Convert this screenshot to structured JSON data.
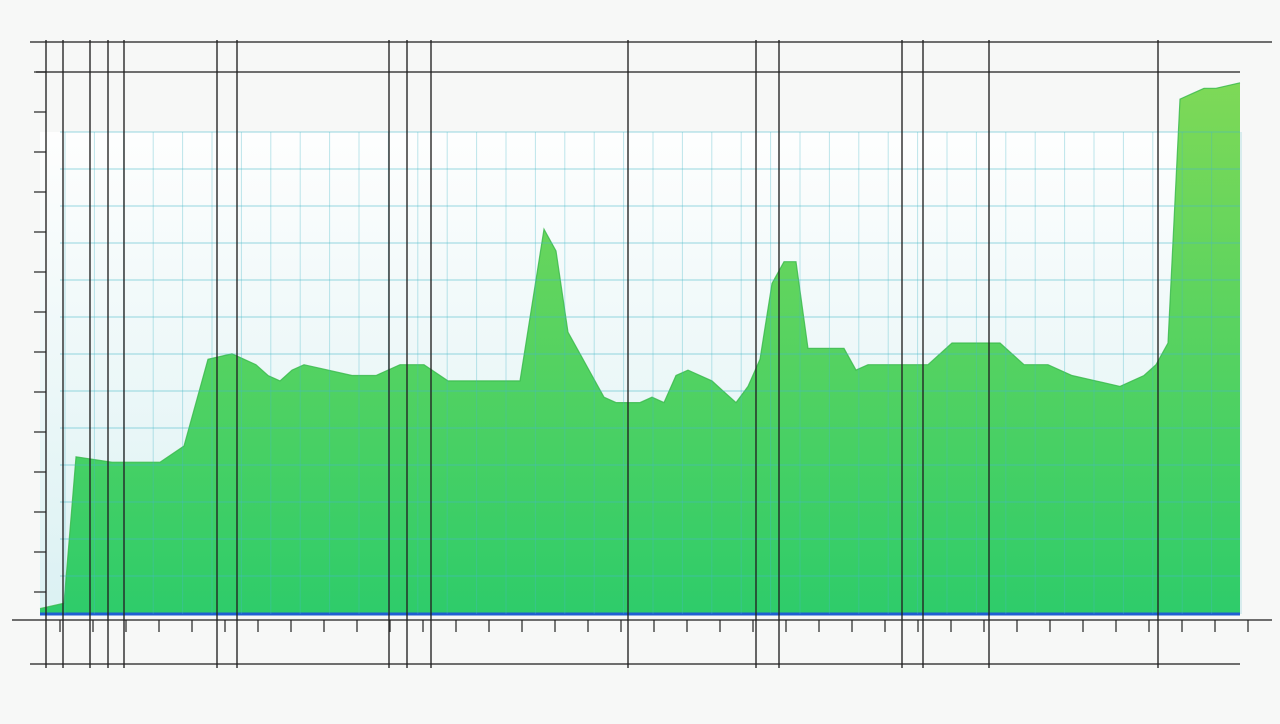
{
  "chart_data": {
    "type": "area",
    "title": "",
    "xlabel": "",
    "ylabel": "",
    "grid": true,
    "legend": "none",
    "xlim": [
      0,
      100
    ],
    "ylim": [
      0,
      100
    ],
    "x": [
      0,
      2,
      3,
      6,
      10,
      12,
      14,
      16,
      18,
      19,
      20,
      21,
      22,
      24,
      26,
      28,
      30,
      32,
      34,
      36,
      38,
      40,
      42,
      43,
      44,
      45,
      46,
      47,
      48,
      49,
      50,
      51,
      52,
      53,
      54,
      56,
      57,
      58,
      59,
      60,
      61,
      62,
      63,
      64,
      65,
      66,
      67,
      68,
      69,
      70,
      72,
      74,
      76,
      78,
      80,
      82,
      84,
      86,
      88,
      90,
      92,
      93,
      94,
      95,
      96,
      97,
      98,
      100
    ],
    "values": [
      1,
      2,
      29,
      28,
      28,
      31,
      47,
      48,
      46,
      44,
      43,
      45,
      46,
      45,
      44,
      44,
      46,
      46,
      43,
      43,
      43,
      43,
      71,
      67,
      52,
      48,
      44,
      40,
      39,
      39,
      39,
      40,
      39,
      44,
      45,
      43,
      41,
      39,
      42,
      47,
      61,
      65,
      65,
      49,
      49,
      49,
      49,
      45,
      46,
      46,
      46,
      46,
      50,
      50,
      50,
      46,
      46,
      44,
      43,
      42,
      44,
      46,
      50,
      95,
      96,
      97,
      97,
      98
    ],
    "colors": {
      "fill_top": "#7ed957",
      "fill_bottom": "#2ecc6a",
      "line": "#1f5fd1",
      "grid": "#46b8c8",
      "frame": "#222222",
      "plot_bg": "#dff3f3"
    }
  }
}
